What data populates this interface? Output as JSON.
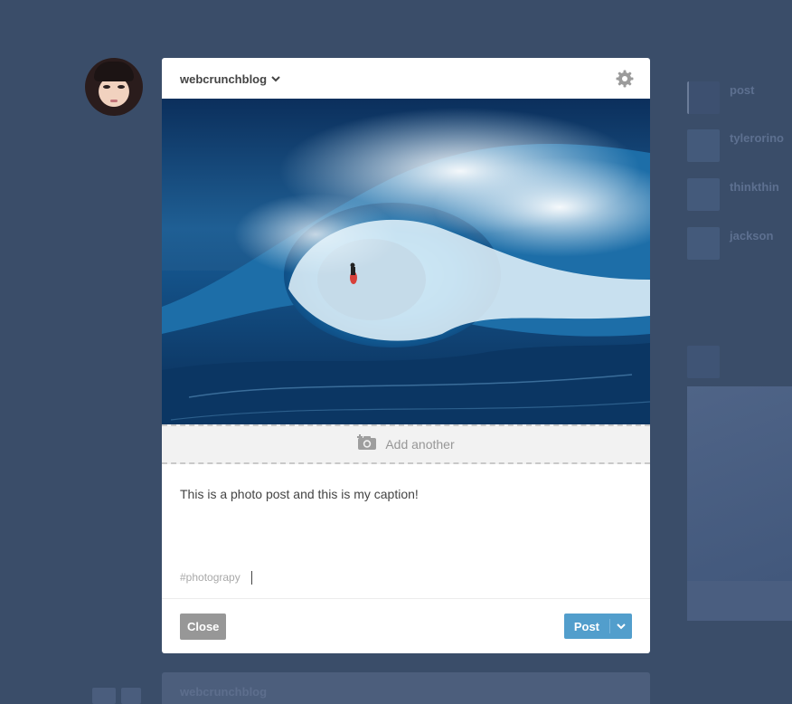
{
  "colors": {
    "backdrop": "#3a4d69",
    "dialog": "#ffffff",
    "post_button": "#529ecc",
    "close_button": "#979797"
  },
  "composer": {
    "blog_name": "webcrunchblog",
    "blog_chevron_icon": "chevron-down-icon",
    "settings_icon": "gear-icon",
    "add_another": {
      "label": "Add another",
      "icon": "camera-plus-icon"
    },
    "caption": "This is a photo post and this is my caption!",
    "tags": [
      "#photograpy"
    ],
    "close_label": "Close",
    "post_label": "Post",
    "post_menu_icon": "chevron-down-icon"
  },
  "background": {
    "sidebar_names": [
      "post",
      "tylerorino",
      "thinkthin",
      "jackson"
    ],
    "next_post_blog": "webcrunchblog"
  }
}
